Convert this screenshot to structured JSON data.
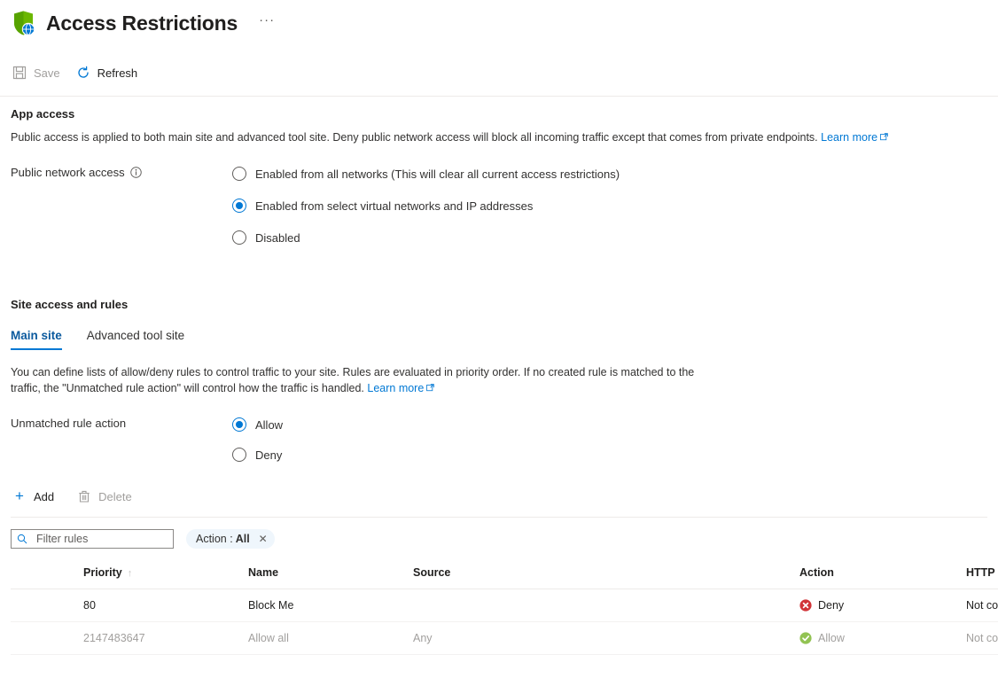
{
  "header": {
    "title": "Access Restrictions",
    "icon": "shield-globe-icon",
    "more_label": "···"
  },
  "command_bar": {
    "items": [
      {
        "label": "Save",
        "icon": "save-icon",
        "disabled": true
      },
      {
        "label": "Refresh",
        "icon": "refresh-icon",
        "disabled": false
      }
    ]
  },
  "app_access": {
    "heading": "App access",
    "description": "Public access is applied to both main site and advanced tool site. Deny public network access will block all incoming traffic except that comes from private endpoints.",
    "learn_more": "Learn more",
    "field_label": "Public network access",
    "info_icon": "info-icon",
    "options": [
      {
        "label": "Enabled from all networks (This will clear all current access restrictions)",
        "checked": false
      },
      {
        "label": "Enabled from select virtual networks and IP addresses",
        "checked": true
      },
      {
        "label": "Disabled",
        "checked": false
      }
    ]
  },
  "site_access": {
    "heading": "Site access and rules",
    "tabs": [
      {
        "label": "Main site",
        "active": true
      },
      {
        "label": "Advanced tool site",
        "active": false
      }
    ],
    "description": "You can define lists of allow/deny rules to control traffic to your site. Rules are evaluated in priority order. If no created rule is matched to the traffic, the \"Unmatched rule action\" will control how the traffic is handled.",
    "learn_more": "Learn more",
    "unmatched_label": "Unmatched rule action",
    "unmatched_options": [
      {
        "label": "Allow",
        "checked": true
      },
      {
        "label": "Deny",
        "checked": false
      }
    ]
  },
  "rules_toolbar": {
    "add_label": "Add",
    "delete_label": "Delete",
    "delete_disabled": true
  },
  "filter": {
    "search_placeholder": "Filter rules",
    "search_value": "",
    "search_icon": "search-icon",
    "pill_key": "Action :",
    "pill_value": "All",
    "pill_close": "✕"
  },
  "rules_table": {
    "columns": [
      {
        "label": "Priority",
        "sort": "↑"
      },
      {
        "label": "Name",
        "sort": ""
      },
      {
        "label": "Source",
        "sort": ""
      },
      {
        "label": "Action",
        "sort": ""
      },
      {
        "label": "HTTP headers",
        "sort": ""
      }
    ],
    "rows": [
      {
        "priority": "80",
        "name": "Block Me",
        "source": "",
        "action": "Deny",
        "action_state": "deny",
        "http_headers": "Not configured",
        "dimmed": false
      },
      {
        "priority": "2147483647",
        "name": "Allow all",
        "source": "Any",
        "action": "Allow",
        "action_state": "allow",
        "http_headers": "Not configured",
        "dimmed": true
      }
    ]
  },
  "colors": {
    "accent": "#0078d4",
    "deny": "#d13438",
    "allow": "#92c353",
    "shield": "#57a300",
    "pill_bg": "#eff6fc"
  }
}
